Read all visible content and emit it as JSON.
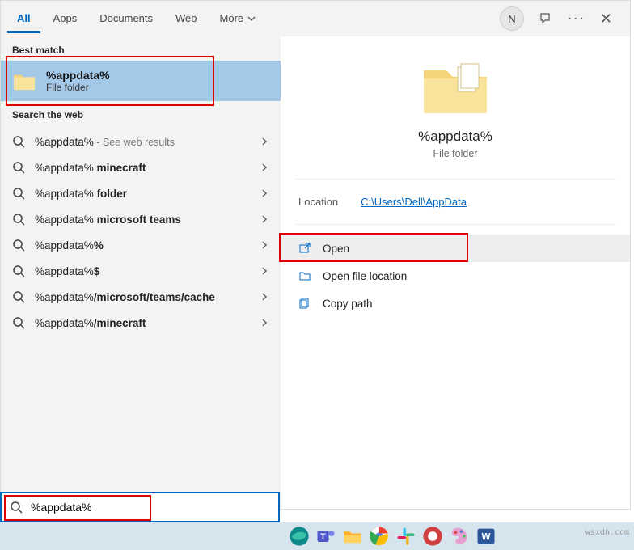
{
  "tabs": {
    "items": [
      "All",
      "Apps",
      "Documents",
      "Web",
      "More"
    ],
    "active": 0
  },
  "header": {
    "avatar_initial": "N"
  },
  "left": {
    "best_match_label": "Best match",
    "best_match": {
      "title": "%appdata%",
      "subtitle": "File folder"
    },
    "search_web_label": "Search the web",
    "web_items": [
      {
        "text": "%appdata%",
        "hint": " - See web results",
        "bold": false
      },
      {
        "text": "%appdata% minecraft",
        "bold_part": "minecraft"
      },
      {
        "text": "%appdata% folder",
        "bold_part": "folder"
      },
      {
        "text": "%appdata% microsoft teams",
        "bold_part": "microsoft teams"
      },
      {
        "text": "%appdata%%",
        "bold_part": "%"
      },
      {
        "text": "%appdata%$",
        "bold_part": "$"
      },
      {
        "text": "%appdata%/microsoft/teams/cache",
        "bold_part": "/microsoft/teams/cache"
      },
      {
        "text": "%appdata%/minecraft",
        "bold_part": "/minecraft"
      }
    ]
  },
  "right": {
    "title": "%appdata%",
    "subtitle": "File folder",
    "location_label": "Location",
    "location_value": "C:\\Users\\Dell\\AppData",
    "actions": [
      {
        "icon": "open",
        "label": "Open",
        "highlight": true
      },
      {
        "icon": "location",
        "label": "Open file location"
      },
      {
        "icon": "copy",
        "label": "Copy path"
      }
    ]
  },
  "search": {
    "value": "%appdata%"
  },
  "watermark": "wsxdn.com"
}
